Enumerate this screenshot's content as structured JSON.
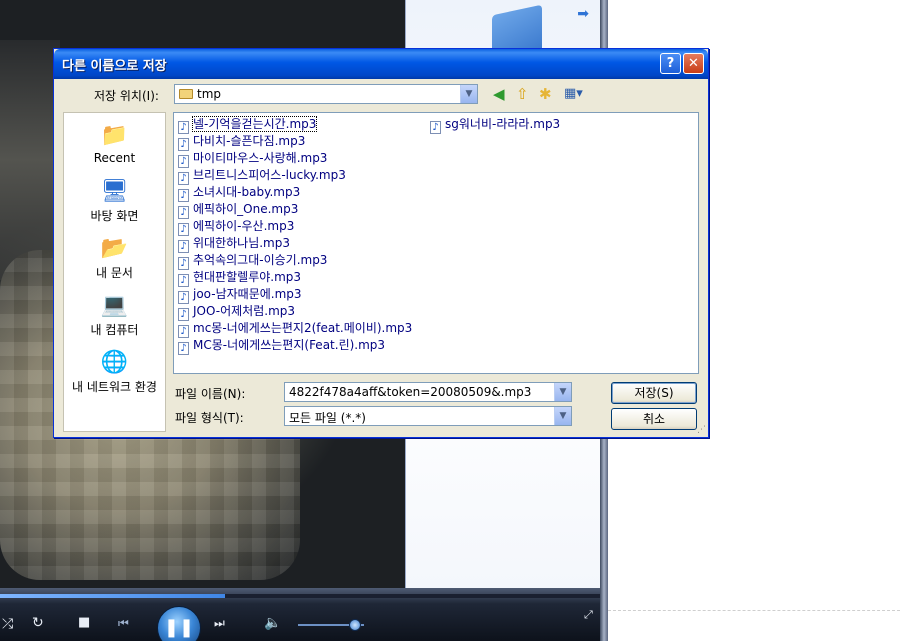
{
  "dialog": {
    "title": "다른 이름으로 저장",
    "help_glyph": "?",
    "close_glyph": "✕",
    "save_in_label": "저장 위치(I):",
    "save_in_value": "tmp",
    "places": [
      {
        "label": "Recent",
        "icon": "recent-folder-icon"
      },
      {
        "label": "바탕 화면",
        "icon": "desktop-icon"
      },
      {
        "label": "내 문서",
        "icon": "my-documents-icon"
      },
      {
        "label": "내 컴퓨터",
        "icon": "my-computer-icon"
      },
      {
        "label": "내 네트워크 환경",
        "icon": "network-icon"
      }
    ],
    "files": [
      "넬-기억을걷는시간.mp3",
      "다비치-슬픈다짐.mp3",
      "마이티마우스-사랑해.mp3",
      "브리트니스피어스-lucky.mp3",
      "소녀시대-baby.mp3",
      "에픽하이_One.mp3",
      "에픽하이-우산.mp3",
      "위대한하나님.mp3",
      "추억속의그대-이승기.mp3",
      "현대판할렐루야.mp3",
      "joo-남자때문에.mp3",
      "JOO-어제처럼.mp3",
      "mc몽-너에게쓰는편지2(feat.메이비).mp3",
      "MC몽-너에게쓰는편지(Feat.린).mp3",
      "sg워너비-라라라.mp3"
    ],
    "file_name_label": "파일 이름(N):",
    "file_name_value": "4822f478a4aff&token=20080509&.mp3",
    "file_type_label": "파일 형식(T):",
    "file_type_value": "모든 파일 (*.*)",
    "save_button": "저장(S)",
    "cancel_button": "취소"
  },
  "player": {
    "seek_progress": 0.375,
    "volume_level": 0.85
  },
  "colors": {
    "titlebar": "#0054e3",
    "dialog_face": "#ece9d8",
    "file_text": "#000080"
  }
}
